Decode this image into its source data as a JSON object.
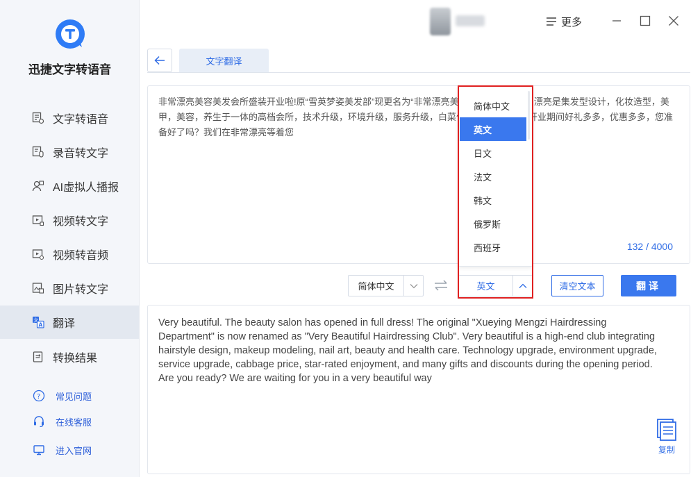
{
  "app": {
    "name": "迅捷文字转语音"
  },
  "sidebar": {
    "items": [
      {
        "label": "文字转语音"
      },
      {
        "label": "录音转文字"
      },
      {
        "label": "AI虚拟人播报"
      },
      {
        "label": "视频转文字"
      },
      {
        "label": "视频转音频"
      },
      {
        "label": "图片转文字"
      },
      {
        "label": "翻译"
      },
      {
        "label": "转换结果"
      }
    ],
    "active_index": 6,
    "bottom_links": [
      {
        "label": "常见问题"
      },
      {
        "label": "在线客服"
      },
      {
        "label": "进入官网"
      }
    ]
  },
  "topbar": {
    "more_label": "更多"
  },
  "tabs": {
    "active_label": "文字翻译"
  },
  "source": {
    "text": "非常漂亮美容美发会所盛装开业啦!原“雪英梦姿美发部”现更名为“非常漂亮美容美发会所”，非常漂亮是集发型设计，化妆造型，美甲，美容，养生于一体的高档会所，技术升级，环境升级，服务升级，白菜价格，星级享受，开业期间好礼多多，优惠多多，您准备好了吗？我们在非常漂亮等着您",
    "char_count": "132 / 4000"
  },
  "controls": {
    "source_lang": "简体中文",
    "target_lang": "英文",
    "clear_label": "清空文本",
    "translate_label": "翻译"
  },
  "dropdown": {
    "options": [
      "简体中文",
      "英文",
      "日文",
      "法文",
      "韩文",
      "俄罗斯",
      "西班牙"
    ],
    "selected": "英文"
  },
  "result": {
    "text": "Very beautiful. The beauty salon has opened in full dress! The original \"Xueying Mengzi Hairdressing Department\" is now renamed as \"Very Beautiful Hairdressing Club\". Very beautiful is a high-end club integrating hairstyle design, makeup modeling, nail art, beauty and health care. Technology upgrade, environment upgrade, service upgrade, cabbage price, star-rated enjoyment, and many gifts and discounts during the opening period. Are you ready? We are waiting for you in a very beautiful way",
    "copy_label": "复制"
  },
  "colors": {
    "accent": "#3a78ee",
    "link": "#2f6ce5",
    "highlight": "#e02020",
    "sidebar_bg": "#f4f6fa"
  }
}
